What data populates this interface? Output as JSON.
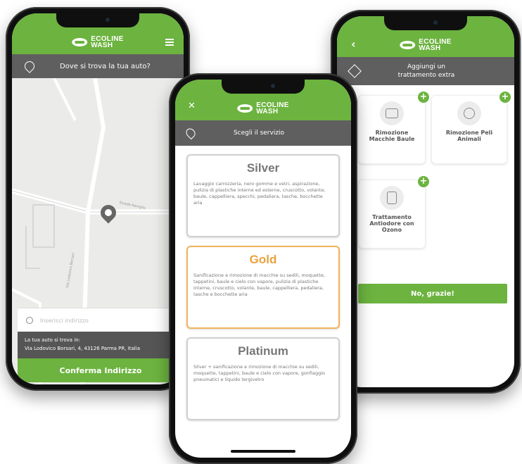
{
  "app": {
    "brand_line1": "ECOLINE",
    "brand_line2": "WASH"
  },
  "left_phone": {
    "header_question": "Dove si trova la tua auto?",
    "search_placeholder": "Inserisci indirizzo",
    "address_label": "La tua auto si trova in:",
    "address_value": "Via Lodovico Borsari, 4, 43126 Parma PR, Italia",
    "confirm_label": "Conferma Indirizzo",
    "map_labels": {
      "street_1": "Strada Naviglio",
      "street_2": "Via Lodovico Borsari"
    }
  },
  "center_phone": {
    "header_title": "Scegli il servizio",
    "services": [
      {
        "name": "Silver",
        "description": "Lavaggio carrozzeria, nero gomme e vetri, aspirazione, pulizia di plastiche interne ed esterne, cruscotto, volante, baule, cappelliera, specchi, pedaliera, tasche, bocchette aria"
      },
      {
        "name": "Gold",
        "description": "Sanificazione e rimozione di macchie su sedili, moquette, tappetini, baule e cielo con vapore, pulizia di plastiche interne, cruscotto, volante, baule, cappelliera, pedaliera, tasche e bocchette aria"
      },
      {
        "name": "Platinum",
        "description": "Silver + sanificazione e rimozione di macchie su sedili, moquette, tappetini, baule e cielo con vapore, gonfiaggio pneumatici e liquido tergivetro"
      }
    ]
  },
  "right_phone": {
    "header_line1": "Aggiungi un",
    "header_line2": "trattamento extra",
    "extras": [
      {
        "label": "Rimozione Macchie Baule",
        "icon": "car-trunk-icon"
      },
      {
        "label": "Rimozione Peli Animali",
        "icon": "pet-hair-icon"
      },
      {
        "label": "Trattamento Antiodore con Ozono",
        "icon": "ozone-icon"
      }
    ],
    "no_thanks_label": "No, grazie!"
  },
  "colors": {
    "accent_green": "#6cb33f",
    "header_gray": "#5f5f5f",
    "gold": "#e8a23f"
  }
}
